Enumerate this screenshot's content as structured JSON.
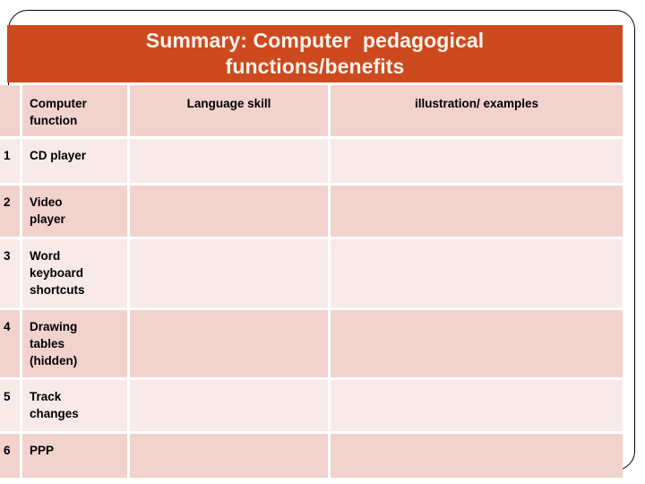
{
  "slide": {
    "title": "Summary: Computer  pedagogical\nfunctions/benefits",
    "accent_color": "#cc4a1e",
    "title_text_color": "#fdf3ec",
    "row_tint_dark": "#f1d2cd",
    "row_tint_light": "#f8eae8",
    "gridline_color": "#ffffff",
    "frame_color": "#000000",
    "background_color": "#ffffff"
  },
  "table": {
    "headers": {
      "number": "",
      "computer_function": "Computer\nfunction",
      "language_skill": "Language skill",
      "illustration_examples": "illustration/ examples"
    },
    "rows": [
      {
        "number": "1",
        "computer_function": "CD player",
        "language_skill": "",
        "illustration_examples": ""
      },
      {
        "number": "2",
        "computer_function": "Video\nplayer",
        "language_skill": "",
        "illustration_examples": ""
      },
      {
        "number": "3",
        "computer_function": "Word\nkeyboard\nshortcuts",
        "language_skill": "",
        "illustration_examples": ""
      },
      {
        "number": "4",
        "computer_function": "Drawing\ntables\n(hidden)",
        "language_skill": "",
        "illustration_examples": ""
      },
      {
        "number": "5",
        "computer_function": "Track\nchanges",
        "language_skill": "",
        "illustration_examples": ""
      },
      {
        "number": "6",
        "computer_function": "PPP",
        "language_skill": "",
        "illustration_examples": ""
      }
    ]
  }
}
